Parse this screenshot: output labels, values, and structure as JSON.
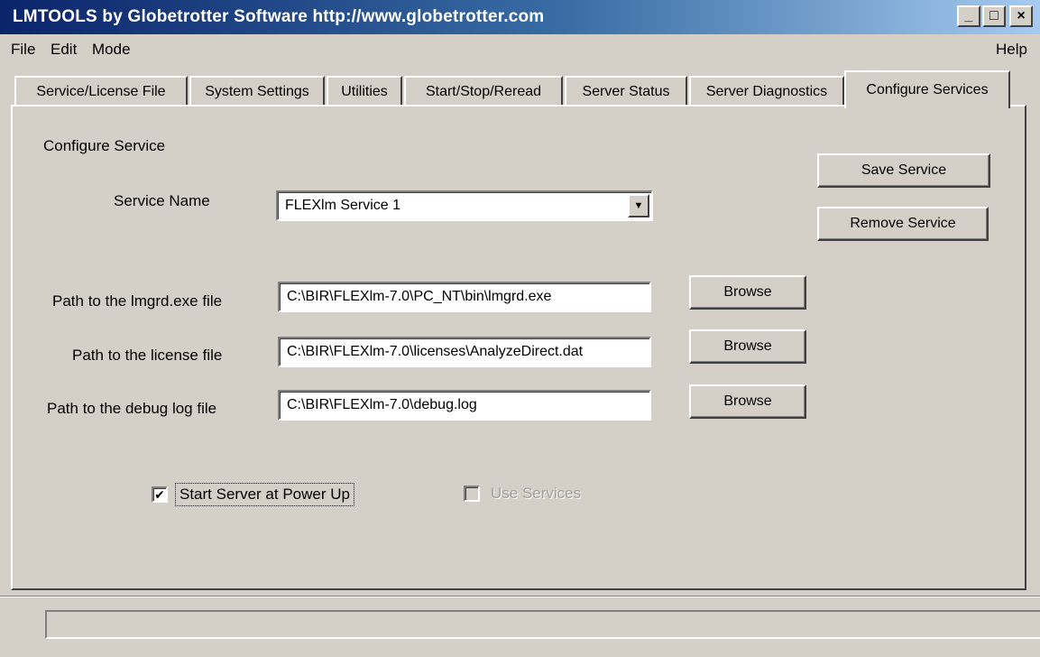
{
  "window": {
    "title": "LMTOOLS by Globetrotter Software http://www.globetrotter.com",
    "minimize": "_",
    "maximize": "□",
    "close": "×"
  },
  "menu": {
    "file": "File",
    "edit": "Edit",
    "mode": "Mode",
    "help": "Help"
  },
  "tabs": [
    "Service/License File",
    "System Settings",
    "Utilities",
    "Start/Stop/Reread",
    "Server Status",
    "Server Diagnostics",
    "Configure Services"
  ],
  "active_tab": "Configure Services",
  "configure": {
    "section_title": "Configure Service",
    "service_name_label": "Service Name",
    "service_name_value": "FLEXlm Service 1",
    "lmgrd_label": "Path to the lmgrd.exe file",
    "lmgrd_value": "C:\\BIR\\FLEXlm-7.0\\PC_NT\\bin\\lmgrd.exe",
    "license_label": "Path to the license file",
    "license_value": "C:\\BIR\\FLEXlm-7.0\\licenses\\AnalyzeDirect.dat",
    "debug_label": "Path to the debug log file",
    "debug_value": "C:\\BIR\\FLEXlm-7.0\\debug.log",
    "browse_label": "Browse",
    "save_label": "Save Service",
    "remove_label": "Remove Service",
    "start_power_label": "Start Server at Power Up",
    "start_power_checked": true,
    "use_services_label": "Use Services",
    "use_services_checked": false,
    "use_services_enabled": false
  },
  "status_text": "",
  "colors": {
    "face": "#d4d0c8",
    "title_start": "#0a246a",
    "title_end": "#a6caf0",
    "disabled_text": "#a0a0a0"
  }
}
